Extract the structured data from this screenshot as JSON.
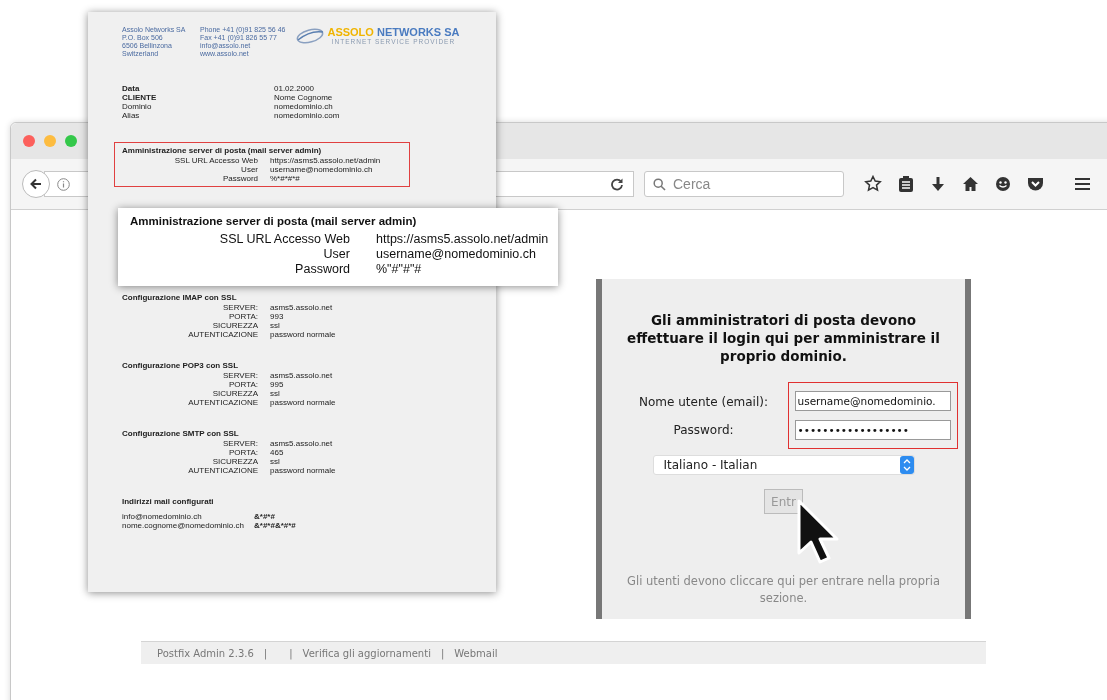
{
  "document": {
    "letterhead": {
      "address_lines": [
        "Assolo Networks SA",
        "P.O. Box 506",
        "6506 Bellinzona",
        "Switzerland"
      ],
      "contact_lines": [
        "Phone  +41 (0)91 825 56 46",
        "Fax     +41 (0)91 826 55 77",
        "info@assolo.net",
        "www.assolo.net"
      ],
      "logo_name_first": "ASSOLO",
      "logo_name_rest": "NETWORKS SA",
      "logo_tagline": "INTERNET SERVICE PROVIDER"
    },
    "info_rows": [
      {
        "label": "Data",
        "value": "01.02.2000",
        "bold": true
      },
      {
        "label": "CLIENTE",
        "value": "Nome Cognome",
        "bold": true
      },
      {
        "label": "Dominio",
        "value": "nomedominio.ch",
        "bold": false
      },
      {
        "label": "Alias",
        "value": "nomedominio.com",
        "bold": false
      }
    ],
    "admin_section": {
      "title": "Amministrazione server di posta (mail server admin)",
      "rows": [
        {
          "label": "SSL URL Accesso Web",
          "value": "https://asms5.assolo.net/admin"
        },
        {
          "label": "User",
          "value": "username@nomedominio.ch"
        },
        {
          "label": "Password",
          "value": "%*#*#*#"
        }
      ]
    },
    "sections": [
      {
        "title": "Configurazione IMAP con SSL",
        "rows": [
          {
            "label": "SERVER:",
            "value": "asms5.assolo.net"
          },
          {
            "label": "PORTA:",
            "value": "993"
          },
          {
            "label": "SICUREZZA",
            "value": "ssl"
          },
          {
            "label": "AUTENTICAZIONE",
            "value": "password normale"
          }
        ]
      },
      {
        "title": "Configurazione POP3 con SSL",
        "rows": [
          {
            "label": "SERVER:",
            "value": "asms5.assolo.net"
          },
          {
            "label": "PORTA:",
            "value": "995"
          },
          {
            "label": "SICUREZZA",
            "value": "ssl"
          },
          {
            "label": "AUTENTICAZIONE",
            "value": "password normale"
          }
        ]
      },
      {
        "title": "Configurazione SMTP con SSL",
        "rows": [
          {
            "label": "SERVER:",
            "value": "asms5.assolo.net"
          },
          {
            "label": "PORTA:",
            "value": "465"
          },
          {
            "label": "SICUREZZA",
            "value": "ssl"
          },
          {
            "label": "AUTENTICAZIONE",
            "value": "password normale"
          }
        ]
      }
    ],
    "addresses": {
      "title": "Indirizzi  mail configurati",
      "rows": [
        {
          "email": "info@nomedominio.ch",
          "password": "&*#*#"
        },
        {
          "email": "nome.cognome@nomedominio.ch",
          "password": "&*#*#&*#*#"
        }
      ]
    }
  },
  "callout": {
    "title": "Amministrazione server di posta (mail server admin)",
    "rows": [
      {
        "label": "SSL URL Accesso Web",
        "value": "https://asms5.assolo.net/admin"
      },
      {
        "label": "User",
        "value": "username@nomedominio.ch"
      },
      {
        "label": "Password",
        "value": "%\"#\"#\"#"
      }
    ]
  },
  "browser": {
    "search_placeholder": "Cerca"
  },
  "login": {
    "heading": "Gli amministratori di posta devono effettuare il login qui per amministrare il proprio dominio.",
    "username_label": "Nome utente (email):",
    "username_value": "username@nomedominio.",
    "password_label": "Password:",
    "password_value": "••••••••••••••••••",
    "language": "Italiano - Italian",
    "submit_label": "Entr",
    "note": "Gli utenti devono cliccare qui per entrare nella propria sezione."
  },
  "footer": {
    "items": [
      {
        "text": "Postfix Admin 2.3.6",
        "kind": "link"
      },
      {
        "text": "|",
        "kind": "separator"
      },
      {
        "text": "|",
        "kind": "separator"
      },
      {
        "text": "Verifica gli aggiornamenti",
        "kind": "link"
      },
      {
        "text": "|",
        "kind": "separator"
      },
      {
        "text": "Webmail",
        "kind": "link"
      }
    ]
  }
}
